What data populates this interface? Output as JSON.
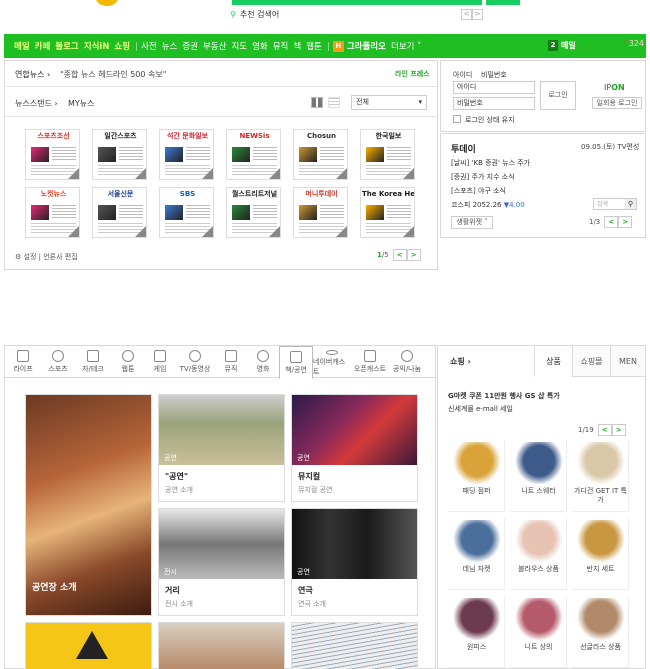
{
  "search": {
    "suggestion": "추천 검색어",
    "arrow_prev": "<",
    "arrow_next": ">"
  },
  "gnb": {
    "services_lime": [
      "메일",
      "카페",
      "블로그",
      "지식iN",
      "쇼핑"
    ],
    "services_white": [
      "사전",
      "뉴스",
      "증권",
      "부동산",
      "지도",
      "영화",
      "뮤직",
      "책",
      "웹툰"
    ],
    "grafolio_badge": "H",
    "grafolio": "그라폴리오",
    "more": "더보기 ˅",
    "notice_count": "2",
    "notice_label": "메일",
    "user_count": "324",
    "user_count_arrow": "↑"
  },
  "news": {
    "headline_source": "연합뉴스 ›",
    "headline_text": "\"종합 뉴스 헤드라인 500 속보\"",
    "headline_right": "라인 프레스",
    "newsstand_label": "뉴스스탠드 ›",
    "my_label": "MY뉴스",
    "dropdown_value": "전체",
    "settings_label": "설정 | 언론사 편집",
    "page_current": "1",
    "page_total": "/5",
    "prev": "<",
    "next": ">",
    "papers": [
      {
        "name": "스포츠조선",
        "color": "#d8261f"
      },
      {
        "name": "일간스포츠",
        "color": "#1d1d1d"
      },
      {
        "name": "석간 문화일보",
        "color": "#c9252b"
      },
      {
        "name": "NEWSis",
        "color": "#d22a2a"
      },
      {
        "name": "Chosun",
        "color": "#333"
      },
      {
        "name": "한국일보",
        "color": "#1a1a1a"
      },
      {
        "name": "노컷뉴스",
        "color": "#e53a1f"
      },
      {
        "name": "서울신문",
        "color": "#1b3f8c"
      },
      {
        "name": "SBS",
        "color": "#0a5fad"
      },
      {
        "name": "월스트리트저널",
        "color": "#222"
      },
      {
        "name": "머니투데이",
        "color": "#c0392b"
      },
      {
        "name": "The Korea Herald",
        "color": "#1a1a1a"
      }
    ]
  },
  "login": {
    "title_id": "아이디",
    "title_pw": "비밀번호",
    "id_placeholder": "아이디",
    "pw_placeholder": "비밀번호",
    "login_button": "로그인",
    "keep_label": "로그인 상태 유지",
    "ip_label": "IP",
    "ip_state": "ON",
    "onetime_button": "일회용 로그인"
  },
  "today": {
    "title": "투데이",
    "date": "09.05.(토) TV편성",
    "line1": "[날씨] 'KB 증권' 뉴스 주가",
    "line2": "[증권] 주가 지수 소식",
    "line3": "[스포츠] 야구 소식",
    "index_label": "코스피",
    "index_value": "2052.26",
    "index_change": "▼4.00",
    "widget_button": "생활위젯 ˅",
    "page": "1/3",
    "prev": "<",
    "next": ">",
    "search_placeholder": "검색"
  },
  "categories": [
    {
      "label": "라이프",
      "icon": "house-icon"
    },
    {
      "label": "스포츠",
      "icon": "ball-icon"
    },
    {
      "label": "자/테크",
      "icon": "car-icon"
    },
    {
      "label": "웹툰",
      "icon": "book-icon"
    },
    {
      "label": "게임",
      "icon": "gamepad-icon"
    },
    {
      "label": "TV/동영상",
      "icon": "tv-icon"
    },
    {
      "label": "뮤직",
      "icon": "play-icon"
    },
    {
      "label": "영화",
      "icon": "film-icon"
    },
    {
      "label": "책/공연",
      "icon": "open-book-icon"
    },
    {
      "label": "네이버캐스트",
      "icon": "broadcast-icon"
    },
    {
      "label": "오픈캐스트",
      "icon": "opencast-icon"
    },
    {
      "label": "공익/나눔",
      "icon": "heart-icon"
    }
  ],
  "tiles": [
    {
      "tag": "",
      "title": "공연장 소개",
      "sub": ""
    },
    {
      "tag": "공연",
      "title": "\"공연\"",
      "sub": "공연 소개"
    },
    {
      "tag": "공연",
      "title": "뮤지컬",
      "sub": "뮤지컬 공연"
    },
    {
      "tag": "전시",
      "title": "거리",
      "sub": "전시 소개"
    },
    {
      "tag": "공연",
      "title": "연극",
      "sub": "연극 소개"
    }
  ],
  "shop": {
    "title": "쇼핑 ›",
    "tab_product": "상품",
    "tab_mall": "쇼핑몰",
    "tab_men": "MEN",
    "promo_line1": "G마켓 쿠폰 11만원 행사 GS 샵 특가",
    "promo_line2": "신세계몰 e-mall 세일",
    "page": "1/19",
    "prev": "<",
    "next": ">",
    "products": [
      {
        "name": "패딩 점퍼",
        "color": "#d9a33a"
      },
      {
        "name": "니트 스웨터",
        "color": "#3d5a8a"
      },
      {
        "name": "가디건 GET IT 특가",
        "color": "#d9c7a8"
      },
      {
        "name": "데님 자켓",
        "color": "#4a6f9c"
      },
      {
        "name": "블라우스 상품",
        "color": "#e6c3b3"
      },
      {
        "name": "반지 세트",
        "color": "#c9973f"
      },
      {
        "name": "원피스",
        "color": "#6b3a4f"
      },
      {
        "name": "니트 상의",
        "color": "#b55a6a"
      },
      {
        "name": "선글라스 상품",
        "color": "#b08a6a"
      }
    ]
  }
}
